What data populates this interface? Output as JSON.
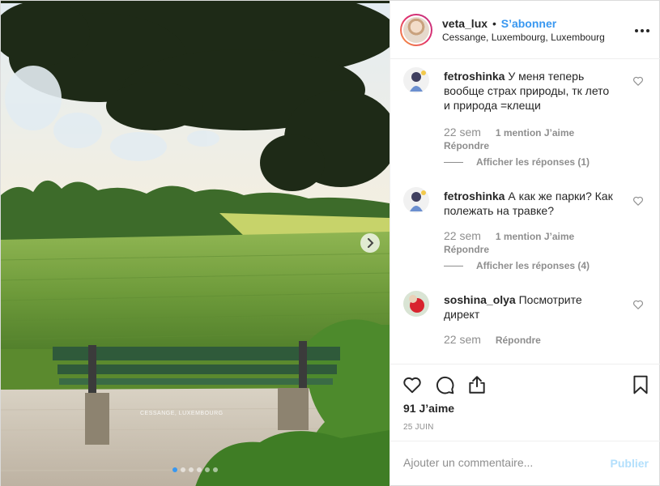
{
  "post": {
    "owner": {
      "username": "veta_lux",
      "separator": "•",
      "follow_label": "S’abonner",
      "location": "Cessange, Luxembourg, Luxembourg"
    },
    "more_icon": "more-options-icon",
    "carousel": {
      "photo_plaque": "CESSANGE, LUXEMBOURG",
      "next_icon": "chevron-right-icon",
      "slide_count": 6,
      "active_slide": 1
    },
    "comments": [
      {
        "username": "fetroshinka",
        "text": "У меня теперь вообще страх природы, тк лето и природа =клещи",
        "time": "22 sem",
        "likes": "1 mention J’aime",
        "reply_label": "Répondre",
        "view_replies": "Afficher les réponses (1)"
      },
      {
        "username": "fetroshinka",
        "text": "А как же парки? Как полежать на травке?",
        "time": "22 sem",
        "likes": "1 mention J’aime",
        "reply_label": "Répondre",
        "view_replies": "Afficher les réponses (4)"
      },
      {
        "username": "soshina_olya",
        "text": "Посмотрите директ",
        "time": "22 sem",
        "reply_label": "Répondre"
      }
    ],
    "actions": {
      "like_icon": "heart-icon",
      "comment_icon": "comment-icon",
      "share_icon": "share-icon",
      "save_icon": "bookmark-icon"
    },
    "likes_count": "91 J’aime",
    "date": "25 JUIN",
    "add_comment": {
      "placeholder": "Ajouter un commentaire...",
      "publish_label": "Publier"
    },
    "colors": {
      "link": "#3897f0",
      "muted": "#8e8e8e",
      "publish_disabled": "#b2dffc",
      "text": "#262626"
    }
  }
}
